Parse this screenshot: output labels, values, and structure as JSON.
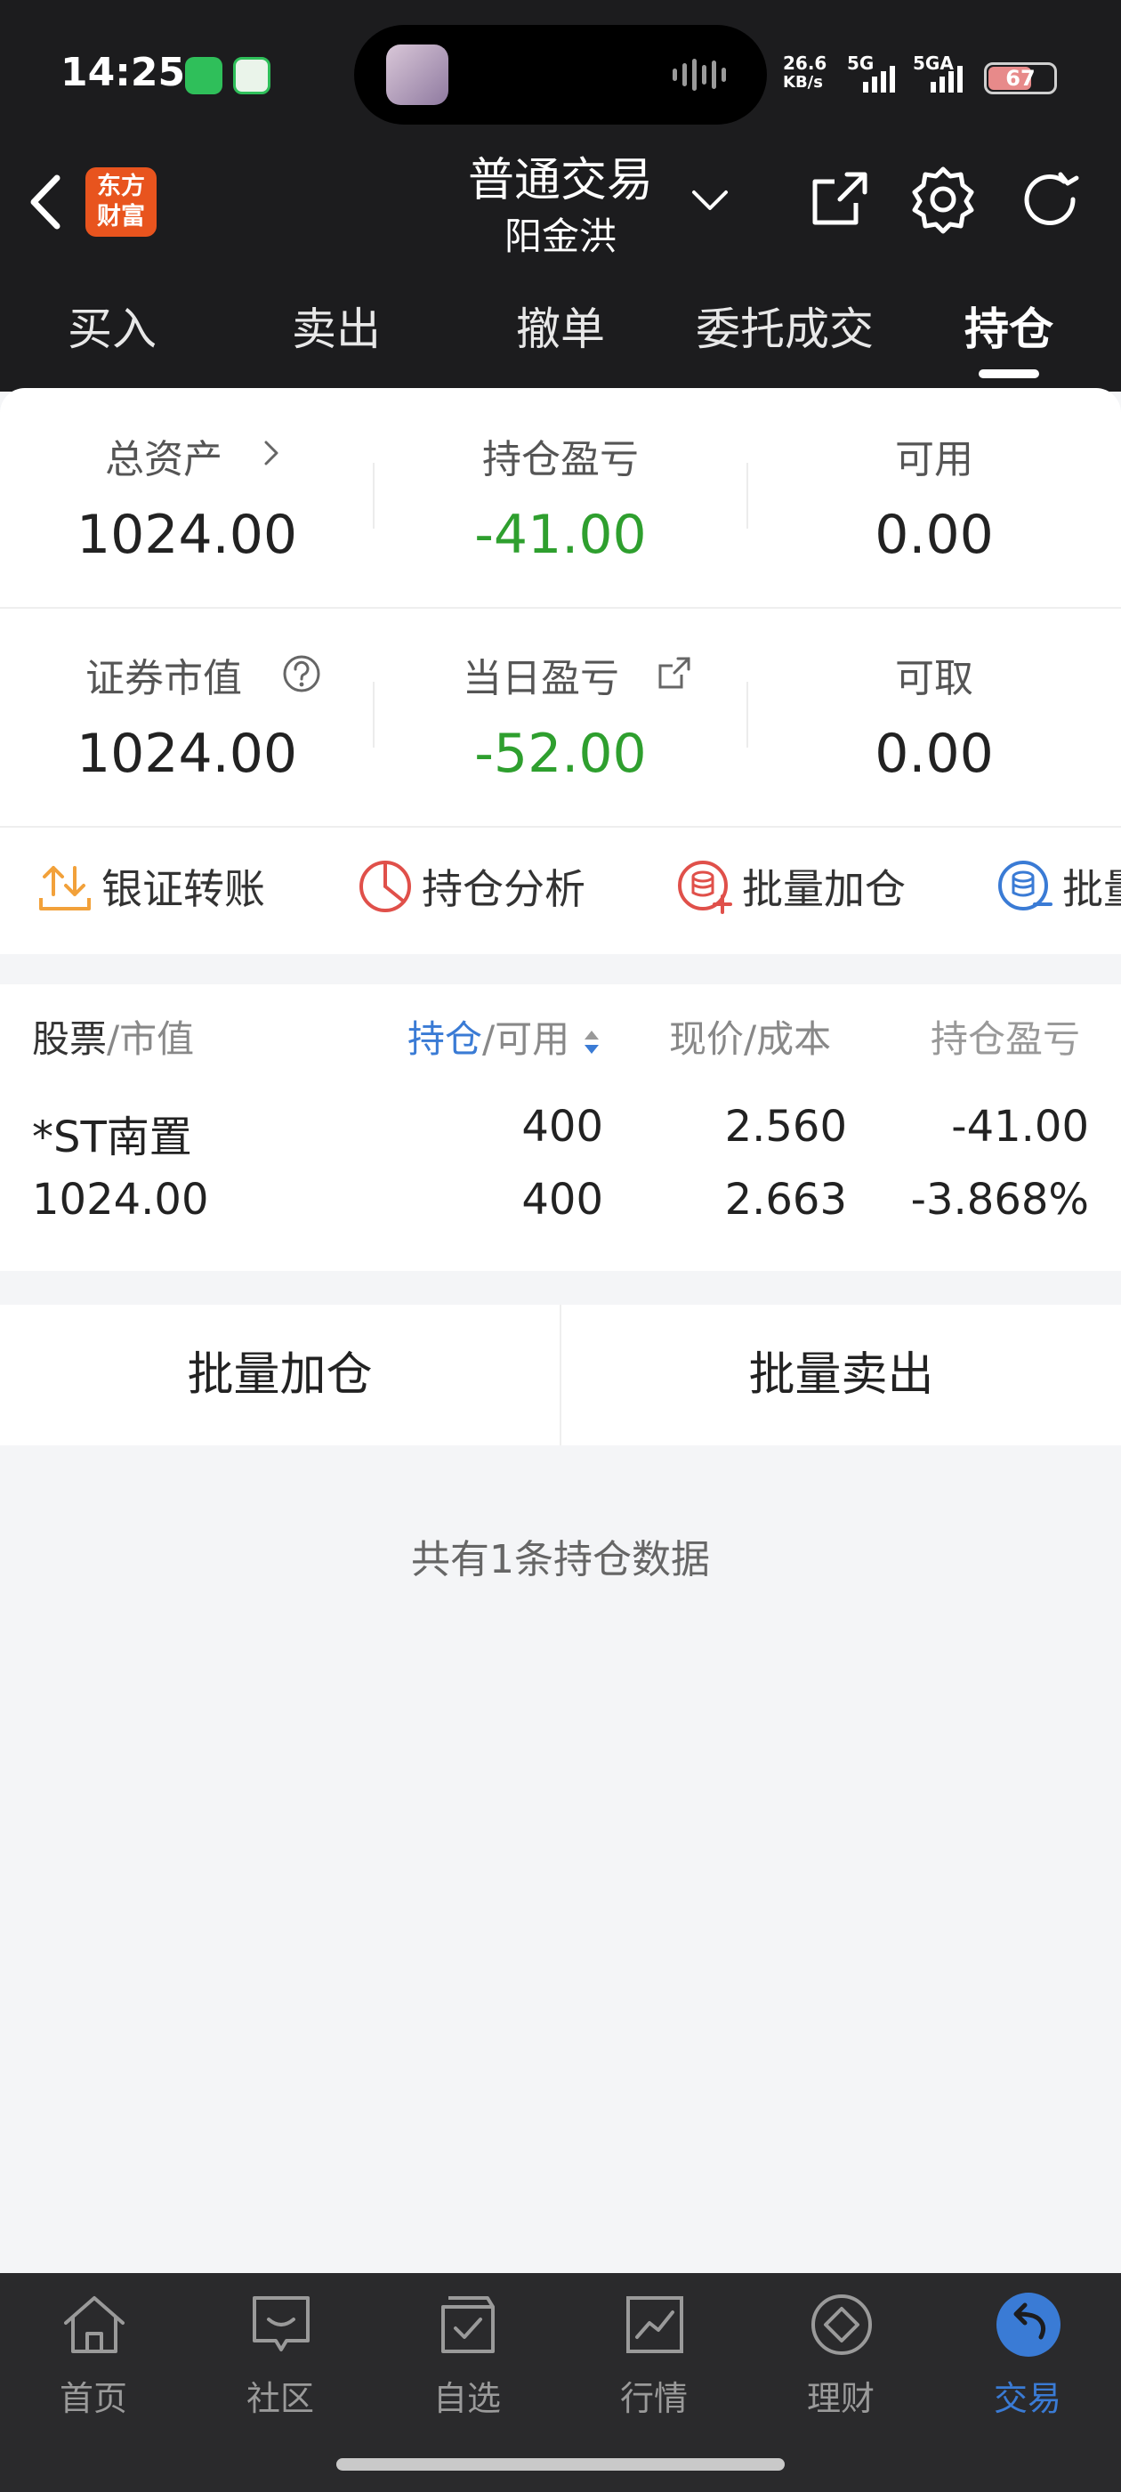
{
  "status_bar": {
    "time": "14:25",
    "net_speed_value": "26.6",
    "net_speed_unit": "KB/s",
    "signal1": "5G",
    "signal2": "5GA",
    "battery": "67",
    "battery_level": 0.67
  },
  "header": {
    "logo_line1": "东方",
    "logo_line2": "财富",
    "title": "普通交易",
    "account": "阳金洪"
  },
  "tabs": [
    {
      "label": "买入"
    },
    {
      "label": "卖出"
    },
    {
      "label": "撤单"
    },
    {
      "label": "委托成交"
    },
    {
      "label": "持仓"
    }
  ],
  "summary": {
    "total_assets_label": "总资产",
    "total_assets": "1024.00",
    "position_pl_label": "持仓盈亏",
    "position_pl": "-41.00",
    "available_label": "可用",
    "available": "0.00",
    "market_value_label": "证券市值",
    "market_value": "1024.00",
    "daily_pl_label": "当日盈亏",
    "daily_pl": "-52.00",
    "withdrawable_label": "可取",
    "withdrawable": "0.00"
  },
  "actions": [
    {
      "label": "银证转账",
      "icon": "transfer-icon"
    },
    {
      "label": "持仓分析",
      "icon": "pie-chart-icon"
    },
    {
      "label": "批量加仓",
      "icon": "batch-add-icon"
    },
    {
      "label": "批量",
      "icon": "batch-sell-icon"
    }
  ],
  "holdings": {
    "headers": {
      "stock": "股票",
      "market_value": "/市值",
      "position": "持仓",
      "available": "/可用",
      "price": "现价/成本",
      "pl": "持仓盈亏"
    },
    "rows": [
      {
        "name": "*ST南置",
        "market_value": "1024.00",
        "position": "400",
        "available": "400",
        "price": "2.560",
        "cost": "2.663",
        "pl": "-41.00",
        "pl_pct": "-3.868%"
      }
    ]
  },
  "buttons": {
    "batch_add": "批量加仓",
    "batch_sell": "批量卖出"
  },
  "footer_note": "共有1条持仓数据",
  "bottom_nav": [
    {
      "label": "首页",
      "icon": "home-icon"
    },
    {
      "label": "社区",
      "icon": "community-icon"
    },
    {
      "label": "自选",
      "icon": "watchlist-icon"
    },
    {
      "label": "行情",
      "icon": "market-icon"
    },
    {
      "label": "理财",
      "icon": "wealth-icon"
    },
    {
      "label": "交易",
      "icon": "trade-icon"
    }
  ],
  "colors": {
    "header_bg": "#1c1c1e",
    "loss_green": "#2e9f2e",
    "accent_blue": "#3a7bd5",
    "logo_orange": "#e8541e"
  }
}
